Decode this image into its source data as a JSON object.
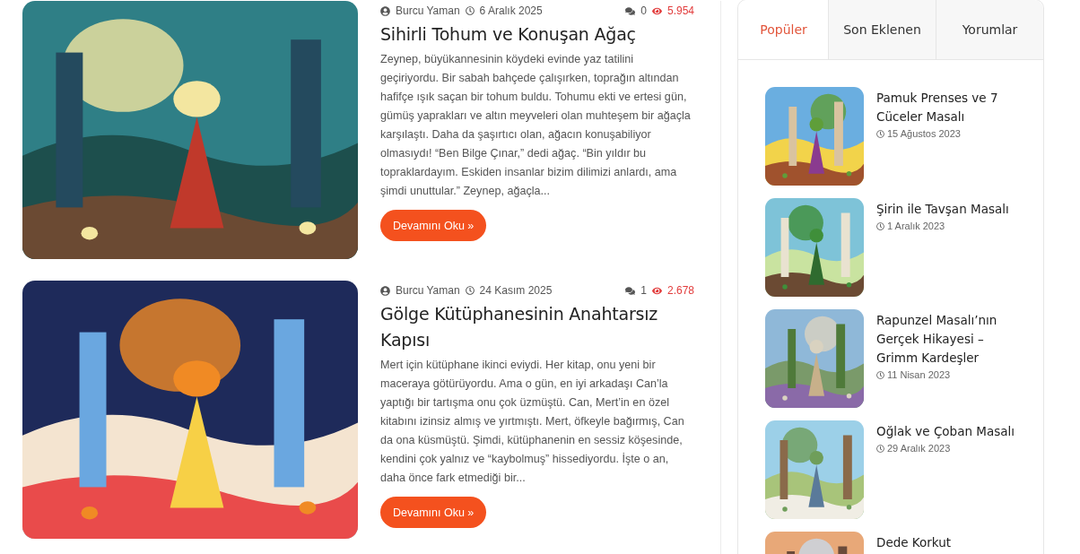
{
  "posts": [
    {
      "author": "Burcu Yaman",
      "date": "6 Aralık 2025",
      "comments": "0",
      "views": "5.954",
      "title": "Sihirli Tohum ve Konuşan Ağaç",
      "excerpt": "Zeynep, büyükannesinin köydeki evinde yaz tatilini geçiriyordu. Bir sabah bahçede çalışırken, toprağın altından hafifçe ışık saçan bir tohum buldu. Tohumu ekti ve ertesi gün, gümüş yaprakları ve altın meyveleri olan muhteşem bir ağaçla karşılaştı. Daha da şaşırtıcı olan, ağacın konuşabiliyor olmasıydı! “Ben Bilge Çınar,” dedi ağaç. “Bin yıldır bu topraklardayım. Eskiden insanlar bizim dilimizi anlardı, ama şimdi unuttular.” Zeynep, ağaçla...",
      "button": "Devamını Oku »"
    },
    {
      "author": "Burcu Yaman",
      "date": "24 Kasım 2025",
      "comments": "1",
      "views": "2.678",
      "title": "Gölge Kütüphanesinin Anahtarsız Kapısı",
      "excerpt": "Mert için kütüphane ikinci eviydi. Her kitap, onu yeni bir maceraya götürüyordu. Ama o gün, en iyi arkadaşı Can’la yaptığı bir tartışma onu çok üzmüştü. Can, Mert’in en özel kitabını izinsiz almış ve yırtmıştı. Mert, öfkeyle bağırmış, Can da ona küsmüştü. Şimdi, kütüphanenin en sessiz köşesinde, kendini çok yalnız ve “kaybolmuş” hissediyordu. İşte o an, daha önce fark etmediği bir...",
      "button": "Devamını Oku »"
    }
  ],
  "sidebar": {
    "tabs": [
      {
        "label": "Popüler",
        "selected": true
      },
      {
        "label": "Son Eklenen",
        "selected": false
      },
      {
        "label": "Yorumlar",
        "selected": false
      }
    ],
    "items": [
      {
        "title": "Pamuk Prenses ve 7 Cüceler Masalı",
        "date": "15 Ağustos 2023"
      },
      {
        "title": "Şirin ile Tavşan Masalı",
        "date": "1 Aralık 2023"
      },
      {
        "title": "Rapunzel Masalı’nın Gerçek Hikayesi – Grimm Kardeşler",
        "date": "11 Nisan 2023"
      },
      {
        "title": "Oğlak ve Çoban Masalı",
        "date": "29 Aralık 2023"
      },
      {
        "title": "Dede Korkut"
      }
    ]
  }
}
